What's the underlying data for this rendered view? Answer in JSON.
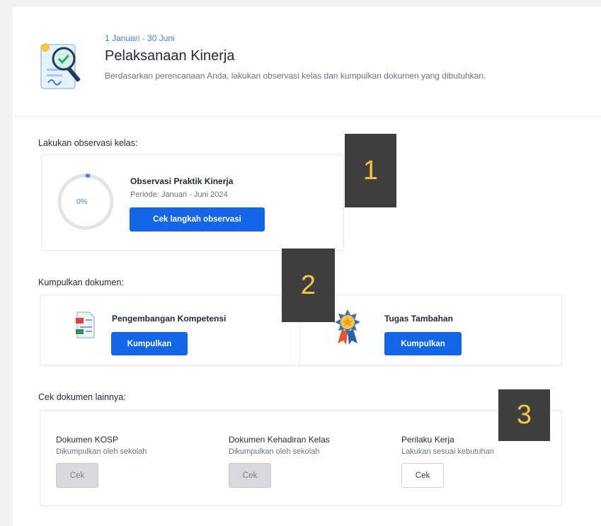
{
  "header": {
    "date_range": "1 Januari - 30 Juni",
    "title": "Pelaksanaan Kinerja",
    "description": "Berdasarkan perencanaan Anda, lakukan observasi kelas dan kumpulkan dokumen yang dibutuhkan."
  },
  "observation": {
    "section_label": "Lakukan observasi kelas:",
    "progress": 0,
    "progress_label": "0%",
    "title": "Observasi Praktik Kinerja",
    "period": "Periode: Januari - Juni 2024",
    "button_label": "Cek langkah observasi"
  },
  "documents": {
    "section_label": "Kumpulkan dokumen:",
    "items": [
      {
        "title": "Pengembangan Kompetensi",
        "button_label": "Kumpulkan",
        "icon": "document-icon"
      },
      {
        "title": "Tugas Tambahan",
        "button_label": "Kumpulkan",
        "icon": "award-medal-icon"
      }
    ]
  },
  "other_documents": {
    "section_label": "Cek dokumen lainnya:",
    "items": [
      {
        "title": "Dokumen KOSP",
        "subtitle": "Dikumpulkan oleh sekolah",
        "button_label": "Cek",
        "enabled": false
      },
      {
        "title": "Dokumen Kehadiran Kelas",
        "subtitle": "Dikumpulkan oleh sekolah",
        "button_label": "Cek",
        "enabled": false
      },
      {
        "title": "Perilaku Kerja",
        "subtitle": "Lakukan sesuai kebutuhan",
        "button_label": "Cek",
        "enabled": true
      }
    ]
  },
  "markers": [
    "1",
    "2",
    "3"
  ],
  "colors": {
    "primary": "#1466e8",
    "accent_text": "#3b82f6",
    "marker_bg": "#3f3f3f",
    "marker_text": "#f6c542"
  }
}
